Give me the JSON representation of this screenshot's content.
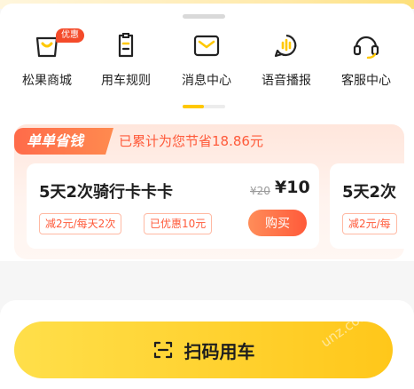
{
  "nav": {
    "items": [
      {
        "label": "松果商城",
        "icon": "shopping-bag-icon",
        "badge": "优惠"
      },
      {
        "label": "用车规则",
        "icon": "document-icon"
      },
      {
        "label": "消息中心",
        "icon": "envelope-icon"
      },
      {
        "label": "语音播报",
        "icon": "voice-broadcast-icon"
      },
      {
        "label": "客服中心",
        "icon": "headset-icon"
      }
    ],
    "page_indicator": {
      "current": 1,
      "total": 2
    }
  },
  "savings": {
    "tag": "单单省钱",
    "summary": "已累计为您节省18.86元",
    "cards": [
      {
        "title": "5天2次骑行卡卡卡",
        "original_price": "¥20",
        "price": "¥10",
        "chips": [
          "减2元/每天2次",
          "已优惠10元"
        ],
        "buy_label": "购买"
      },
      {
        "title": "5天2次",
        "chips": [
          "减2元/每"
        ]
      }
    ]
  },
  "scan": {
    "label": "扫码用车",
    "icon": "scan-icon"
  },
  "watermark": "unz.com",
  "colors": {
    "accent_yellow": "#ffc71a",
    "accent_orange": "#ff5a3a",
    "savings_bg": "#ffe6dc"
  }
}
